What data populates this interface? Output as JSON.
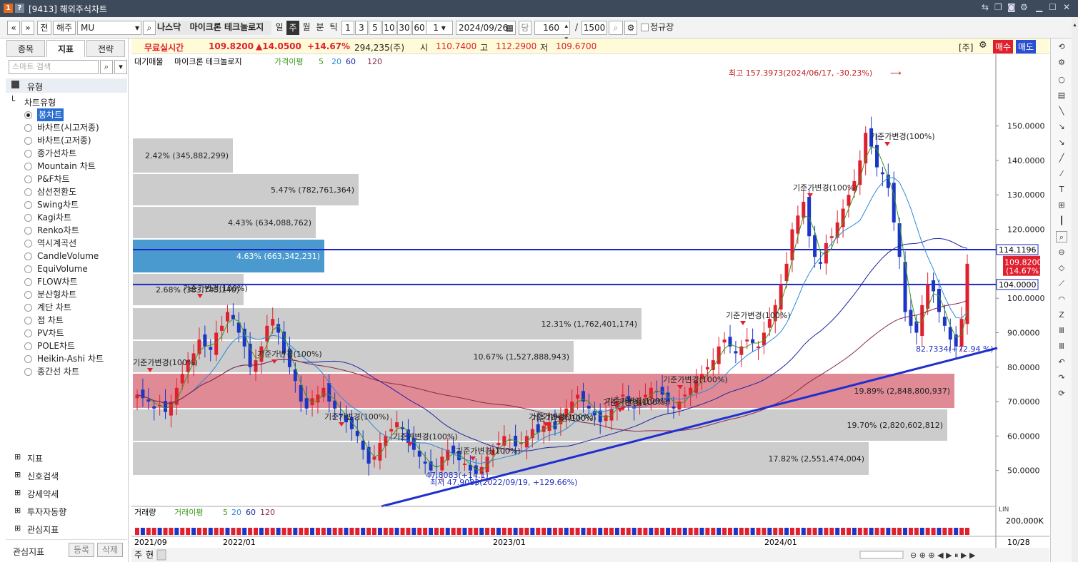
{
  "window": {
    "badge1": "1",
    "badge2": "?",
    "title": "[9413] 해외주식차트",
    "icons": [
      "pin-icon",
      "copy-icon",
      "camera-icon",
      "settings-icon",
      "minimize-icon",
      "maximize-icon",
      "close-icon"
    ]
  },
  "toolbar": {
    "prev": "«",
    "next": "»",
    "jeon": "전",
    "market": "해주",
    "symbol": "MU",
    "exchange": "나스닥",
    "name": "마이크론 테크놀로지",
    "periods": [
      "일",
      "주",
      "월",
      "분",
      "틱"
    ],
    "active_period": "주",
    "nums": [
      "1",
      "3",
      "5",
      "10",
      "30",
      "60"
    ],
    "unit": "1",
    "date": "2024/09/26",
    "dang": "당",
    "count": "160",
    "slash": "/",
    "total": "1500",
    "regular_label": "정규장"
  },
  "left": {
    "tabs": [
      "종목",
      "지표",
      "전략"
    ],
    "active_tab": "지표",
    "search_placeholder": "스마트 검색",
    "section": "유형",
    "group": "차트유형",
    "types": [
      "봉차트",
      "바차트(시고저종)",
      "바차트(고저종)",
      "종가선차트",
      "Mountain 차트",
      "P&F차트",
      "삼선전환도",
      "Swing차트",
      "Kagi차트",
      "Renko차트",
      "역시계곡선",
      "CandleVolume",
      "EquiVolume",
      "FLOW차트",
      "분산형차트",
      "계단 차트",
      "점 차트",
      "PV차트",
      "POLE차트",
      "Heikin-Ashi 차트",
      "종간선 차트"
    ],
    "selected_type": "봉차트",
    "folders": [
      "지표",
      "신호검색",
      "강세약세",
      "투자자동향",
      "관심지표"
    ],
    "footer": {
      "label": "관심지표",
      "register": "등록",
      "delete": "삭제"
    }
  },
  "infobar": {
    "realtime": "무료실시간",
    "price": "109.8200",
    "change": "▲14.0500",
    "pct": "+14.67%",
    "volume": "294,235(주)",
    "open_label": "시",
    "open": "110.7400",
    "high_label": "고",
    "high": "112.2900",
    "low_label": "저",
    "low": "109.6700",
    "lot": "[주]",
    "buy": "매수",
    "sell": "매도"
  },
  "legend": {
    "l1": "대기매물",
    "l2": "마이크론 테크놀로지",
    "l3": "가격이평",
    "ma1": "5",
    "ma2": "20",
    "ma3": "60",
    "ma4": "120",
    "vol1": "거래량",
    "vol2": "거래이평",
    "vma1": "5",
    "vma2": "20",
    "vma3": "60",
    "vma4": "120"
  },
  "colors": {
    "up": "#e0202e",
    "down": "#1a35c8",
    "ma5": "#3a9a1a",
    "ma20": "#2a8adb",
    "ma60": "#1a25a0",
    "ma120": "#8a2a4a",
    "trend": "#1f2fd0"
  },
  "chart_data": {
    "type": "candlestick",
    "ylim": [
      40,
      170
    ],
    "y_ticks": [
      "150.0000",
      "140.0000",
      "130.0000",
      "120.0000",
      "110.0000",
      "100.0000",
      "90.0000",
      "80.0000",
      "70.0000",
      "60.0000",
      "50.0000"
    ],
    "x_ticks": [
      "2021/09",
      "2022/01",
      "2023/01",
      "2024/01"
    ],
    "x_end": "10/28",
    "high_annot": "최고 157.3973(2024/06/17, -30.23%)",
    "low_annot": "최저 47.9083(2022/09/19, +129.66%)",
    "low_annot2": "47.8083(+14.1)",
    "right_annot": "82.7334(+72.94 %)",
    "price_tag": "109.8200",
    "price_tag2": "(14.67%)",
    "line_tag1": "114.1196",
    "line_tag2": "104.0000",
    "vol_tick": "200,000K",
    "vol_scale": "LIN",
    "profile": [
      {
        "label": "2.42% (345,882,299)"
      },
      {
        "label": "5.47% (782,761,364)"
      },
      {
        "label": "4.43% (634,088,762)"
      },
      {
        "label": "4.63% (663,342,231)"
      },
      {
        "label": "2.68% (383,745,140)"
      },
      {
        "label": "12.31% (1,762,401,174)"
      },
      {
        "label": "10.67% (1,527,888,943)"
      },
      {
        "label": "19.89% (2,848,800,937)"
      },
      {
        "label": "19.70% (2,820,602,812)"
      },
      {
        "label": "17.82% (2,551,474,004)"
      }
    ],
    "events": [
      "기준가변경(100%)",
      "기준가변경(100%)",
      "기준가변경(100%)",
      "기준가변경(100%)",
      "기준가변경(100%)",
      "기준가변경(100%)",
      "기준가변경(100%)",
      "기준가변경(100%)",
      "기준가변경(100%)",
      "기준가변경(100%)",
      "기준가변경(100%)",
      "기준가변경(100%)",
      "기준가변경(100%)",
      "기준가변경(100%)"
    ],
    "closes": [
      72,
      71,
      70,
      68,
      69,
      67,
      70,
      74,
      78,
      82,
      84,
      88,
      86,
      85,
      90,
      92,
      96,
      94,
      90,
      86,
      80,
      82,
      86,
      92,
      94,
      90,
      84,
      80,
      76,
      70,
      68,
      71,
      72,
      74,
      70,
      68,
      66,
      64,
      62,
      60,
      56,
      52,
      54,
      58,
      60,
      62,
      64,
      62,
      58,
      56,
      54,
      52,
      50,
      51,
      54,
      56,
      55,
      53,
      52,
      50,
      49,
      51,
      54,
      56,
      58,
      60,
      59,
      57,
      58,
      60,
      62,
      61,
      63,
      64,
      62,
      66,
      68,
      70,
      72,
      70,
      68,
      66,
      64,
      66,
      68,
      70,
      72,
      70,
      68,
      70,
      72,
      74,
      73,
      72,
      70,
      68,
      70,
      72,
      74,
      76,
      78,
      80,
      82,
      86,
      88,
      86,
      84,
      86,
      88,
      87,
      86,
      90,
      94,
      98,
      104,
      110,
      120,
      124,
      128,
      118,
      112,
      110,
      116,
      118,
      122,
      126,
      130,
      134,
      140,
      148,
      144,
      138,
      136,
      132,
      122,
      112,
      96,
      92,
      90,
      98,
      104,
      102,
      96,
      92,
      88,
      86,
      94,
      110
    ]
  },
  "footer": {
    "view_label": "주",
    "view_label2": "현"
  }
}
